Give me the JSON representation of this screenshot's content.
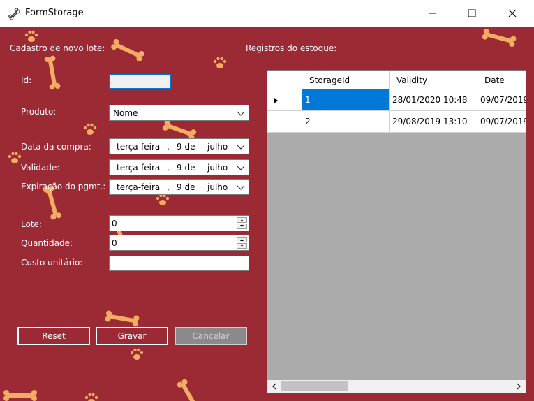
{
  "window": {
    "title": "FormStorage",
    "icon": "bone-icon"
  },
  "form": {
    "section_title": "Cadastro de novo lote:",
    "id": {
      "label": "Id:",
      "value": ""
    },
    "produto": {
      "label": "Produto:",
      "value": "Nome"
    },
    "data_compra": {
      "label": "Data da compra:",
      "weekday": "terça-feira",
      "sep": ",",
      "day": "9 de",
      "month": "julho"
    },
    "validade": {
      "label": "Validade:",
      "weekday": "terça-feira",
      "sep": ",",
      "day": "9 de",
      "month": "julho"
    },
    "expiracao": {
      "label": "Expiração do pgmt.:",
      "weekday": "terça-feira",
      "sep": ",",
      "day": "9 de",
      "month": "julho"
    },
    "lote": {
      "label": "Lote:",
      "value": "0"
    },
    "quantidade": {
      "label": "Quantidade:",
      "value": "0"
    },
    "custo": {
      "label": "Custo unitário:",
      "value": ""
    },
    "buttons": {
      "reset": "Reset",
      "gravar": "Gravar",
      "cancelar": "Cancelar"
    }
  },
  "grid": {
    "section_title": "Registros do estoque:",
    "columns": [
      "StorageId",
      "Validity",
      "Date"
    ],
    "rows": [
      {
        "id": "1",
        "validity": "28/01/2020 10:48",
        "date": "09/07/2019"
      },
      {
        "id": "2",
        "validity": "29/08/2019 13:10",
        "date": "09/07/2019"
      }
    ]
  },
  "colors": {
    "background": "#9b2a35",
    "pattern": "#f3ad62",
    "selection": "#0078d7"
  }
}
